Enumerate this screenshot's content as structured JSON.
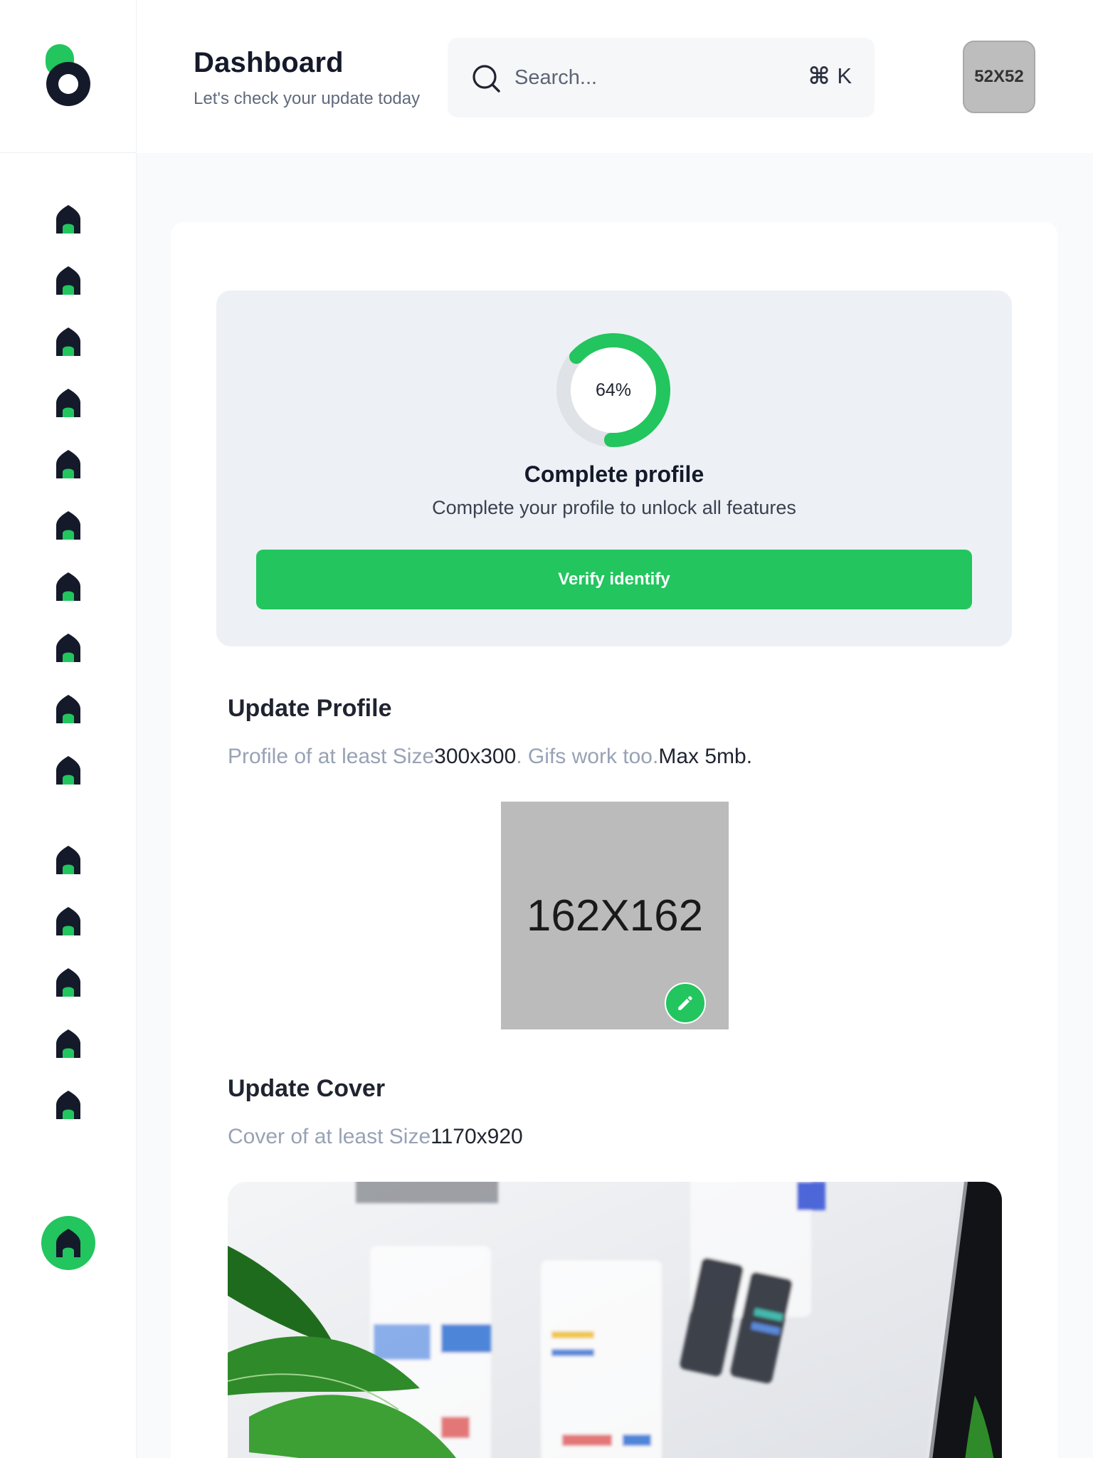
{
  "brand": {
    "accent": "#22c55e",
    "dark": "#141a2a",
    "logo_icon": "brand-logo-icon"
  },
  "header": {
    "title": "Dashboard",
    "subtitle": "Let's check your update today",
    "search": {
      "placeholder": "Search...",
      "icon": "search-icon",
      "shortcut_symbol": "⌘",
      "shortcut_key": "K"
    },
    "avatar_label": "52X52"
  },
  "sidebar": {
    "icon": "home-icon",
    "item_count": 15,
    "active_icon": "home-icon"
  },
  "profile_completion": {
    "percent_label": "64%",
    "progress": 0.64,
    "title": "Complete profile",
    "subtitle": "Complete your profile to unlock all features",
    "button_label": "Verify identify"
  },
  "update_profile": {
    "title": "Update Profile",
    "note_muted_1": "Profile of at least Size",
    "note_dark_1": "300x300",
    "note_muted_2": ". Gifs work too.",
    "note_dark_2": "Max 5mb.",
    "image_placeholder": "162X162",
    "edit_icon": "pencil-icon"
  },
  "update_cover": {
    "title": "Update Cover",
    "note_muted": "Cover of at least Size",
    "note_dark": "1170x920",
    "image_icon": "cover-photo"
  }
}
